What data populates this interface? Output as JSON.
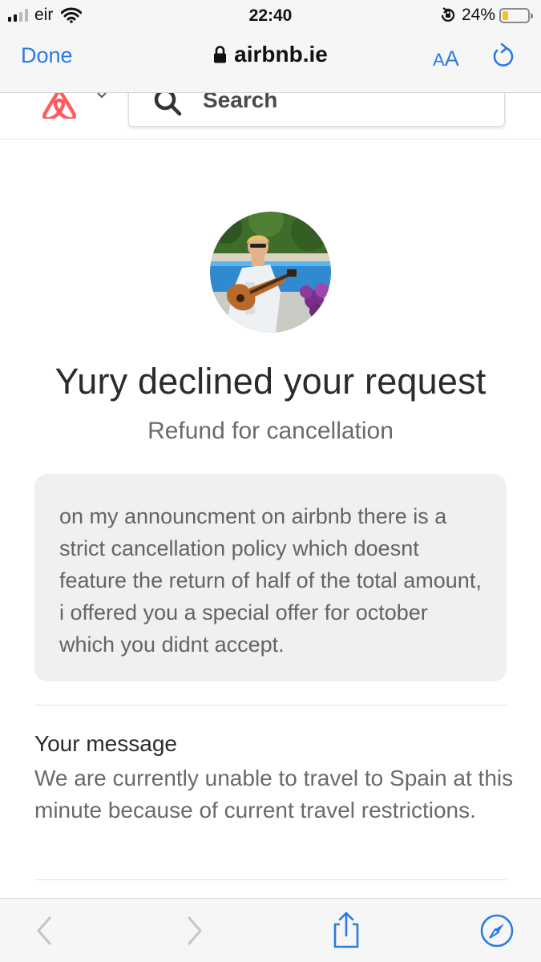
{
  "status_bar": {
    "carrier": "eir",
    "time": "22:40",
    "battery_percent": "24%",
    "battery_level": 0.24,
    "battery_color": "#f3c321",
    "icons": [
      "signal-bars-icon",
      "wifi-icon",
      "orientation-lock-icon",
      "battery-icon"
    ]
  },
  "browser": {
    "done_label": "Done",
    "url": "airbnb.ie",
    "text_size_label_small": "A",
    "text_size_label_big": "A",
    "accent_color": "#2a7be4",
    "icons": [
      "lock-icon",
      "reload-icon"
    ]
  },
  "site_header": {
    "logo": "airbnb-logo-icon",
    "logo_color": "#ff5a5f",
    "search_placeholder": "Search"
  },
  "request": {
    "headline": "Yury declined your request",
    "subhead": "Refund for cancellation",
    "host_message": "on my announcment on airbnb there is a strict cancellation policy which doesnt feature the return of half of the total amount, i offered you a special offer for october which you didnt accept.",
    "your_message_label": "Your message",
    "your_message": "We are currently unable to travel to Spain at this minute because of current travel restrictions."
  },
  "toolbar": {
    "icons": [
      "back-icon",
      "forward-icon",
      "share-icon",
      "compass-icon"
    ]
  }
}
